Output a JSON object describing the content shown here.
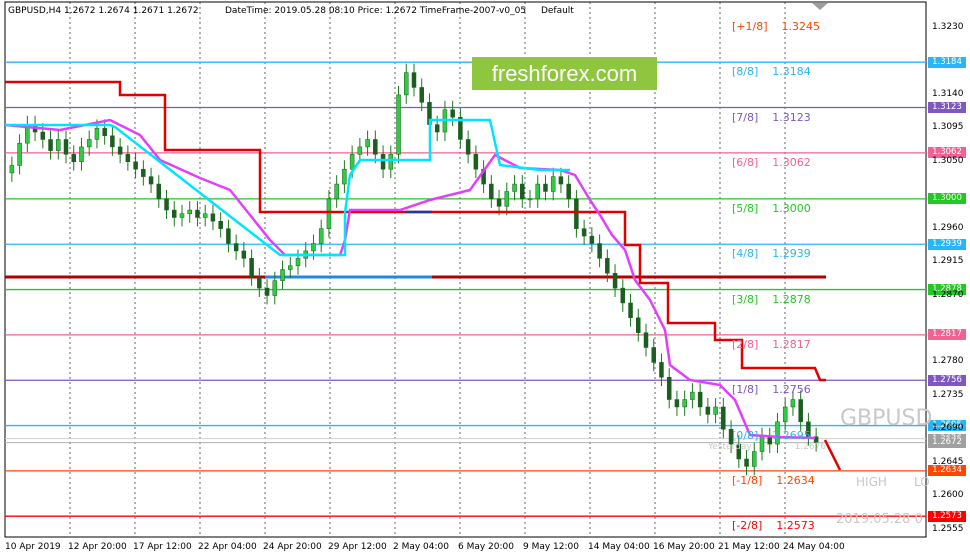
{
  "header": {
    "symbol_info": "GBPUSD,H4  1.2672 1.2674 1.2671 1.2672",
    "info_text": "DateTime: 2019.05.28 08:10    Price: 1.2672    TimeFrame-2007-v0_05",
    "default_label": "Default"
  },
  "logo": {
    "text": "freshforex.com"
  },
  "ghost": {
    "symbol": "GBPUSD",
    "high": "HIGH",
    "low": "LO",
    "date": "2019.05.28 0",
    "yesterday": "Yesterday",
    "yesterday_price": "1.2676"
  },
  "murrey_levels": [
    {
      "label": "[+1/8]",
      "price": "1.3245",
      "value": 1.3245,
      "color": "#ff4500",
      "line": false
    },
    {
      "label": "[8/8]",
      "price": "1.3184",
      "value": 1.3184,
      "color": "#29b6f6",
      "line": true
    },
    {
      "label": "[7/8]",
      "price": "1.3123",
      "value": 1.3123,
      "color": "#7e57c2",
      "line": true
    },
    {
      "label": "[6/8]",
      "price": "1.3062",
      "value": 1.3062,
      "color": "#f06292",
      "line": true
    },
    {
      "label": "[5/8]",
      "price": "1.3000",
      "value": 1.3,
      "color": "#22c922",
      "line": true
    },
    {
      "label": "[4/8]",
      "price": "1.2939",
      "value": 1.2939,
      "color": "#29b6f6",
      "line": true
    },
    {
      "label": "[3/8]",
      "price": "1.2878",
      "value": 1.2878,
      "color": "#22c922",
      "line": true
    },
    {
      "label": "[2/8]",
      "price": "1.2817",
      "value": 1.2817,
      "color": "#f06292",
      "line": true
    },
    {
      "label": "[1/8]",
      "price": "1.2756",
      "value": 1.2756,
      "color": "#7e57c2",
      "line": true
    },
    {
      "label": "[0/8]",
      "price": "1.2695",
      "value": 1.2695,
      "color": "#29b6f6",
      "line": true
    },
    {
      "label": "[-1/8]",
      "price": "1.2634",
      "value": 1.2634,
      "color": "#ff4500",
      "line": true
    },
    {
      "label": "[-2/8]",
      "price": "1.2573",
      "value": 1.2573,
      "color": "#ff0000",
      "line": true
    }
  ],
  "price_axis": [
    "1.3230",
    "1.3140",
    "1.3095",
    "1.3050",
    "1.2960",
    "1.2915",
    "1.2870",
    "1.2780",
    "1.2735",
    "1.2690",
    "1.2645",
    "1.2600",
    "1.2555"
  ],
  "current_price": {
    "text": "1.2672",
    "value": 1.2672,
    "color": "#a0a0a0"
  },
  "tag_1_2676": {
    "text": "1.2676",
    "value": 1.2676,
    "color": "#a0a0a0"
  },
  "time_axis": [
    "10 Apr 2019",
    "12 Apr 20:00",
    "17 Apr 12:00",
    "22 Apr 04:00",
    "24 Apr 20:00",
    "29 Apr 12:00",
    "2 May 04:00",
    "6 May 20:00",
    "9 May 12:00",
    "14 May 04:00",
    "16 May 20:00",
    "21 May 12:00",
    "24 May 04:00"
  ],
  "chart_data": {
    "type": "candlestick",
    "symbol": "GBPUSD",
    "timeframe": "H4",
    "ylim": [
      1.2545,
      1.3265
    ],
    "close_series": [
      1.3045,
      1.3075,
      1.31,
      1.309,
      1.308,
      1.3065,
      1.308,
      1.306,
      1.305,
      1.307,
      1.308,
      1.3095,
      1.3085,
      1.307,
      1.306,
      1.305,
      1.304,
      1.303,
      1.302,
      1.3,
      1.2985,
      1.2975,
      1.298,
      1.2985,
      1.2975,
      1.298,
      1.297,
      1.296,
      1.294,
      1.293,
      1.292,
      1.2895,
      1.288,
      1.287,
      1.289,
      1.2905,
      1.291,
      1.292,
      1.293,
      1.294,
      1.296,
      1.3,
      1.302,
      1.304,
      1.306,
      1.307,
      1.308,
      1.306,
      1.304,
      1.306,
      1.314,
      1.317,
      1.315,
      1.313,
      1.31,
      1.309,
      1.312,
      1.311,
      1.308,
      1.306,
      1.304,
      1.302,
      1.3,
      1.299,
      1.301,
      1.302,
      1.3,
      1.3,
      1.302,
      1.301,
      1.303,
      1.302,
      1.3,
      1.296,
      1.295,
      1.294,
      1.292,
      1.29,
      1.288,
      1.286,
      1.284,
      1.282,
      1.28,
      1.278,
      1.276,
      1.273,
      1.272,
      1.273,
      1.274,
      1.272,
      1.271,
      1.272,
      1.269,
      1.267,
      1.265,
      1.264,
      1.266,
      1.268,
      1.267,
      1.27,
      1.272,
      1.273,
      1.27,
      1.268,
      1.2672
    ]
  }
}
